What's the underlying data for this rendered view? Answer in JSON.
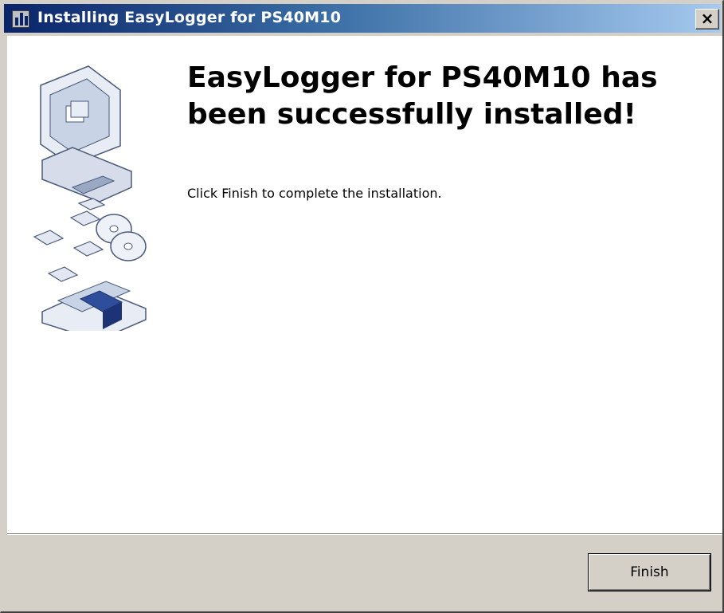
{
  "window": {
    "title": "Installing EasyLogger for PS40M10",
    "close_glyph": "×"
  },
  "main": {
    "heading": "EasyLogger for PS40M10 has been successfully installed!",
    "instruction": "Click Finish to complete the installation."
  },
  "footer": {
    "finish_label": "Finish"
  },
  "icons": {
    "app": "installer-app-icon",
    "illustration": "computer-disks-box-illustration"
  },
  "colors": {
    "titlebar_start": "#0a246a",
    "titlebar_end": "#a6caf0",
    "dialog_face": "#d4d0c8",
    "panel": "#ffffff"
  }
}
